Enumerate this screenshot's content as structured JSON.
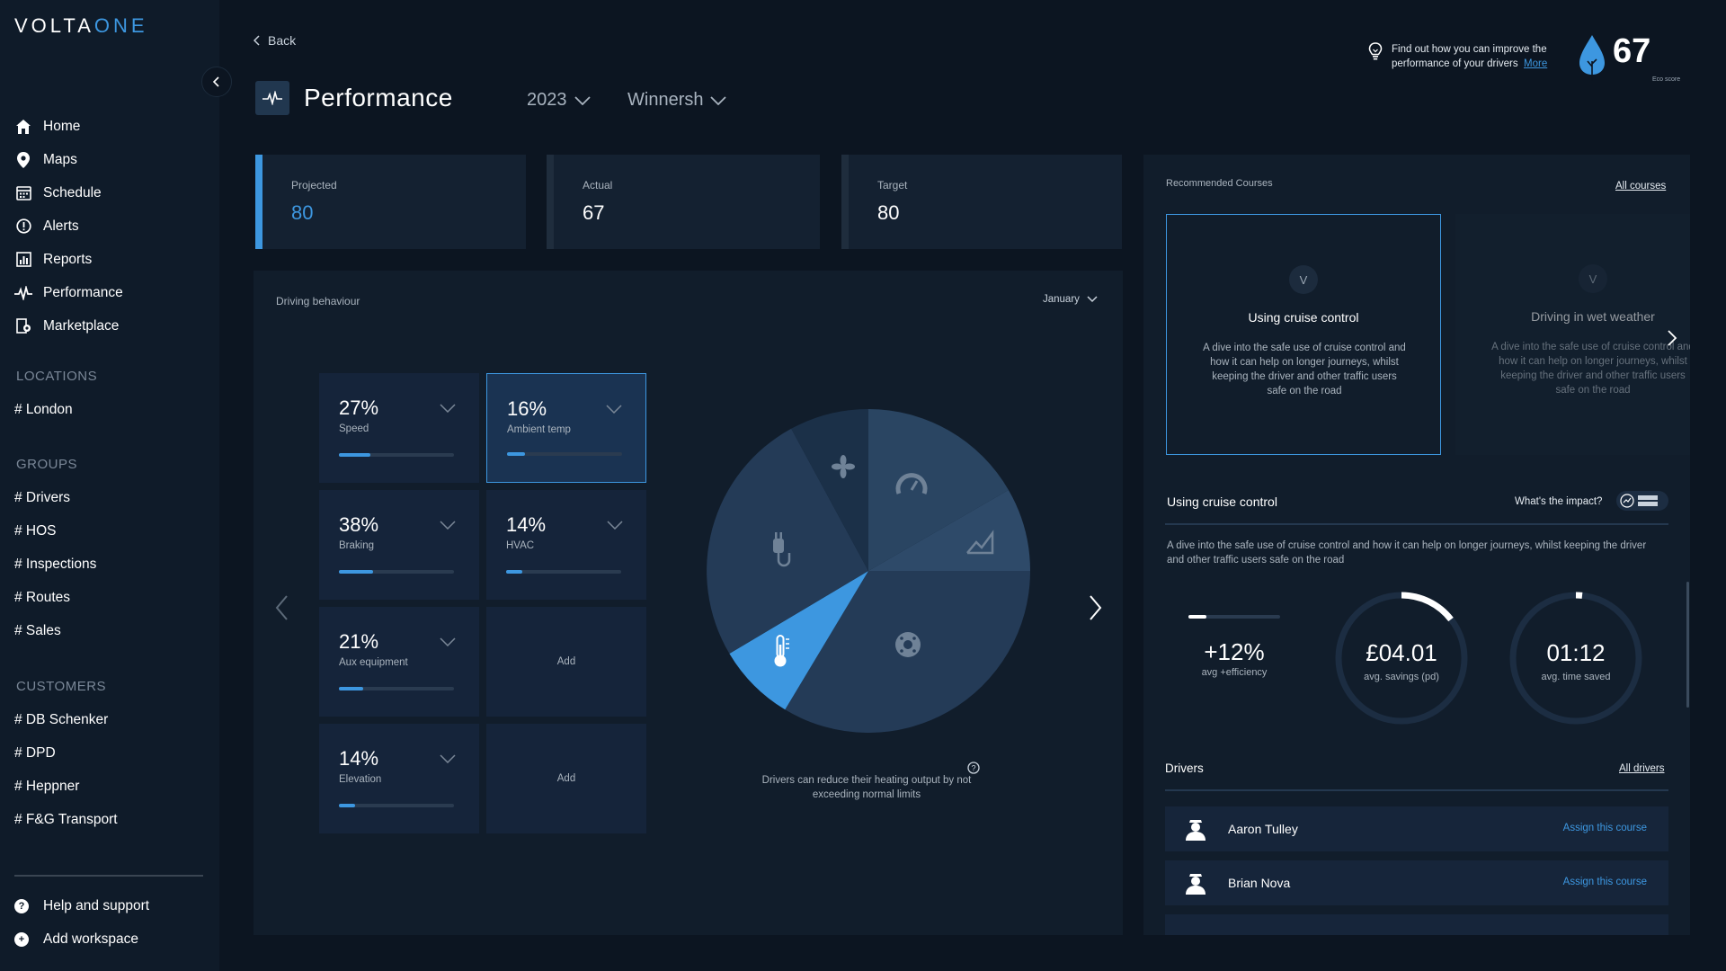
{
  "brand": {
    "logo_a": "VOLTA",
    "logo_b": "ONE"
  },
  "sidebar": {
    "nav": [
      {
        "label": "Home",
        "icon": "home-icon"
      },
      {
        "label": "Maps",
        "icon": "map-pin-icon"
      },
      {
        "label": "Schedule",
        "icon": "calendar-icon"
      },
      {
        "label": "Alerts",
        "icon": "alert-icon"
      },
      {
        "label": "Reports",
        "icon": "reports-icon"
      },
      {
        "label": "Performance",
        "icon": "pulse-icon"
      },
      {
        "label": "Marketplace",
        "icon": "marketplace-icon"
      }
    ],
    "locations_title": "LOCATIONS",
    "locations": [
      "# London"
    ],
    "groups_title": "GROUPS",
    "groups": [
      "# Drivers",
      "# HOS",
      "# Inspections",
      "# Routes",
      "# Sales"
    ],
    "customers_title": "CUSTOMERS",
    "customers": [
      "# DB Schenker",
      "# DPD",
      "# Heppner",
      "# F&G Transport"
    ],
    "help": "Help and support",
    "add_workspace": "Add workspace"
  },
  "header": {
    "back": "Back",
    "title": "Performance",
    "year": "2023",
    "depot": "Winnersh",
    "tip_line1": "Find out how you can improve the",
    "tip_line2": "performance of your drivers",
    "tip_link": "More",
    "eco_score": "67",
    "eco_label": "Eco score"
  },
  "kpis": [
    {
      "label": "Projected",
      "value": "80"
    },
    {
      "label": "Actual",
      "value": "67"
    },
    {
      "label": "Target",
      "value": "80"
    }
  ],
  "driving": {
    "title": "Driving behaviour",
    "month": "January",
    "tiles": [
      {
        "pct": "27%",
        "name": "Speed",
        "fill": 0.27
      },
      {
        "pct": "16%",
        "name": "Ambient temp",
        "fill": 0.16
      },
      {
        "pct": "38%",
        "name": "Braking",
        "fill": 0.3
      },
      {
        "pct": "14%",
        "name": "HVAC",
        "fill": 0.14
      },
      {
        "pct": "21%",
        "name": "Aux equipment",
        "fill": 0.21
      },
      {
        "pct": "14%",
        "name": "Elevation",
        "fill": 0.14
      }
    ],
    "add_label": "Add",
    "caption": "Drivers can reduce their heating output by not exceeding normal limits",
    "colors": {
      "selected": "#3d97e0",
      "slice_dark": "#1b3048",
      "slice_mid": "#243b57",
      "slice_light": "#2e4a69"
    }
  },
  "courses": {
    "title": "Recommended Courses",
    "all_link": "All courses",
    "items": [
      {
        "badge": "V",
        "title": "Using cruise control",
        "desc": "A dive into the safe use of cruise control and how it can help on longer journeys, whilst keeping the driver and other traffic users safe on the road"
      },
      {
        "badge": "V",
        "title": "Driving in wet weather",
        "desc": "A dive into the safe use of cruise control and how it can help on longer journeys, whilst keeping the driver and other traffic users safe on the road"
      }
    ]
  },
  "detail": {
    "title": "Using cruise control",
    "impact": "What's the impact?",
    "desc": "A dive into the safe use of cruise control and how it can help on longer journeys, whilst keeping the driver and other traffic users safe on the road",
    "stats": [
      {
        "value": "+12%",
        "label": "avg +efficiency"
      },
      {
        "value": "£04.01",
        "label": "avg. savings (pd)"
      },
      {
        "value": "01:12",
        "label": "avg. time saved"
      }
    ]
  },
  "drivers": {
    "title": "Drivers",
    "all_link": "All drivers",
    "rows": [
      {
        "name": "Aaron Tulley",
        "action": "Assign this course"
      },
      {
        "name": "Brian Nova",
        "action": "Assign this course"
      }
    ]
  }
}
